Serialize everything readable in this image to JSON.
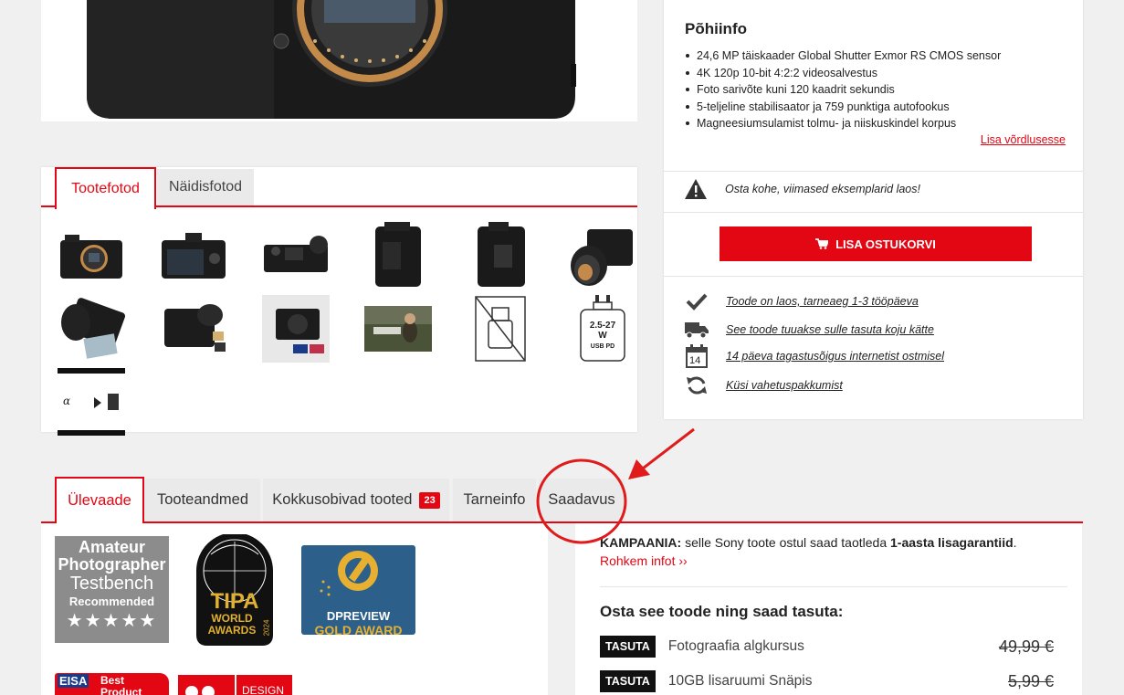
{
  "gallery": {
    "tabs": [
      {
        "label": "Tootefotod",
        "active": true
      },
      {
        "label": "Näidisfotod",
        "active": false
      }
    ],
    "badge_text": "2.5-27 W USB PD"
  },
  "info": {
    "title": "Põhiinfo",
    "specs": [
      "24,6 MP täiskaader Global Shutter Exmor RS CMOS sensor",
      "4K 120p 10-bit 4:2:2 videosalvestus",
      "Foto sarivõte kuni 120 kaadrit sekundis",
      "5-teljeline stabilisaator ja 759 punktiga autofookus",
      "Magneesiumsulamist tolmu- ja niiskuskindel korpus"
    ],
    "compare_link": "Lisa võrdlusesse",
    "stock_warning": "Osta kohe, viimased eksemplarid laos!",
    "cart_button": "LISA OSTUKORVI",
    "features": [
      {
        "icon": "check-icon",
        "text": "Toode on laos, tarneaeg 1-3 tööpäeva"
      },
      {
        "icon": "truck-icon",
        "text": "See toode tuuakse sulle tasuta koju kätte"
      },
      {
        "icon": "calendar-icon",
        "text": "14 päeva tagastusõigus internetist ostmisel"
      },
      {
        "icon": "refresh-icon",
        "text": "Küsi vahetuspakkumist"
      }
    ],
    "calendar_number": "14"
  },
  "tabs": [
    {
      "label": "Ülevaade",
      "active": true
    },
    {
      "label": "Tooteandmed",
      "active": false
    },
    {
      "label": "Kokkusobivad tooted",
      "active": false,
      "badge": "23"
    },
    {
      "label": "Tarneinfo",
      "active": false
    },
    {
      "label": "Saadavus",
      "active": false
    }
  ],
  "awards": {
    "ap_lines": [
      "Amateur",
      "Photographer",
      "Testbench",
      "Recommended"
    ],
    "tipa_lines": [
      "TIPA",
      "WORLD",
      "AWARDS",
      "2024"
    ],
    "dpreview_lines": [
      "DPREVIEW",
      "GOLD AWARD"
    ],
    "eisa_lines": [
      "EISA",
      "Best",
      "Product"
    ],
    "design_label": "DESIGN"
  },
  "promo": {
    "campaign_label": "KAMPAANIA:",
    "campaign_text": " selle Sony toote ostul saad taotleda ",
    "campaign_bold": "1-aasta lisagarantiid",
    "campaign_end": ".",
    "more_link": "Rohkem infot ››",
    "free_title": "Osta see toode ning saad tasuta:",
    "free_items": [
      {
        "tag": "TASUTA",
        "name": "Fotograafia algkursus",
        "price": "49,99 €"
      },
      {
        "tag": "TASUTA",
        "name": "10GB lisaruumi Snäpis",
        "price": "5,99 €"
      }
    ]
  },
  "colors": {
    "accent": "#e30613"
  }
}
